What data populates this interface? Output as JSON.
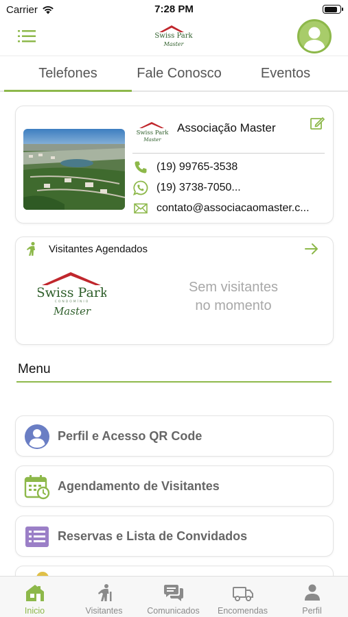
{
  "status_bar": {
    "carrier": "Carrier",
    "time": "7:28 PM",
    "battery_level": 0.9
  },
  "header": {
    "logo_text": "Swiss Park",
    "logo_subtext": "Master",
    "menu_icon": "hamburger-icon",
    "avatar_icon": "user-avatar-icon"
  },
  "tabs": [
    {
      "label": "Telefones",
      "active": true
    },
    {
      "label": "Fale Conosco",
      "active": false
    },
    {
      "label": "Eventos",
      "active": false
    }
  ],
  "association": {
    "name": "Associação Master",
    "logo_text": "Swiss Park",
    "logo_subtext": "Master",
    "phone": "(19) 99765-3538",
    "whatsapp": "(19) 3738-7050...",
    "email": "contato@associacaomaster.c...",
    "edit_icon": "edit-icon"
  },
  "visitors": {
    "title": "Visitantes Agendados",
    "empty_line1": "Sem visitantes",
    "empty_line2": "no momento",
    "logo_text": "Swiss Park",
    "logo_tagline": "CONDOMÍNIO",
    "logo_subtext": "Master"
  },
  "menu": {
    "heading": "Menu",
    "items": [
      {
        "label": "Perfil e Acesso QR Code",
        "icon": "profile-qr-icon",
        "color": "#6a7ec4"
      },
      {
        "label": "Agendamento de Visitantes",
        "icon": "calendar-clock-icon",
        "color": "#8db84a"
      },
      {
        "label": "Reservas e Lista de Convidados",
        "icon": "list-icon",
        "color": "#9b7fc7"
      }
    ]
  },
  "bottom_nav": [
    {
      "label": "Inicio",
      "icon": "home-icon",
      "active": true
    },
    {
      "label": "Visitantes",
      "icon": "visitor-icon",
      "active": false
    },
    {
      "label": "Comunicados",
      "icon": "chat-icon",
      "active": false
    },
    {
      "label": "Encomendas",
      "icon": "truck-icon",
      "active": false
    },
    {
      "label": "Perfil",
      "icon": "person-icon",
      "active": false
    }
  ],
  "colors": {
    "accent": "#8db84a",
    "logo_red": "#c0272d",
    "text_muted": "#a8a8a8"
  }
}
